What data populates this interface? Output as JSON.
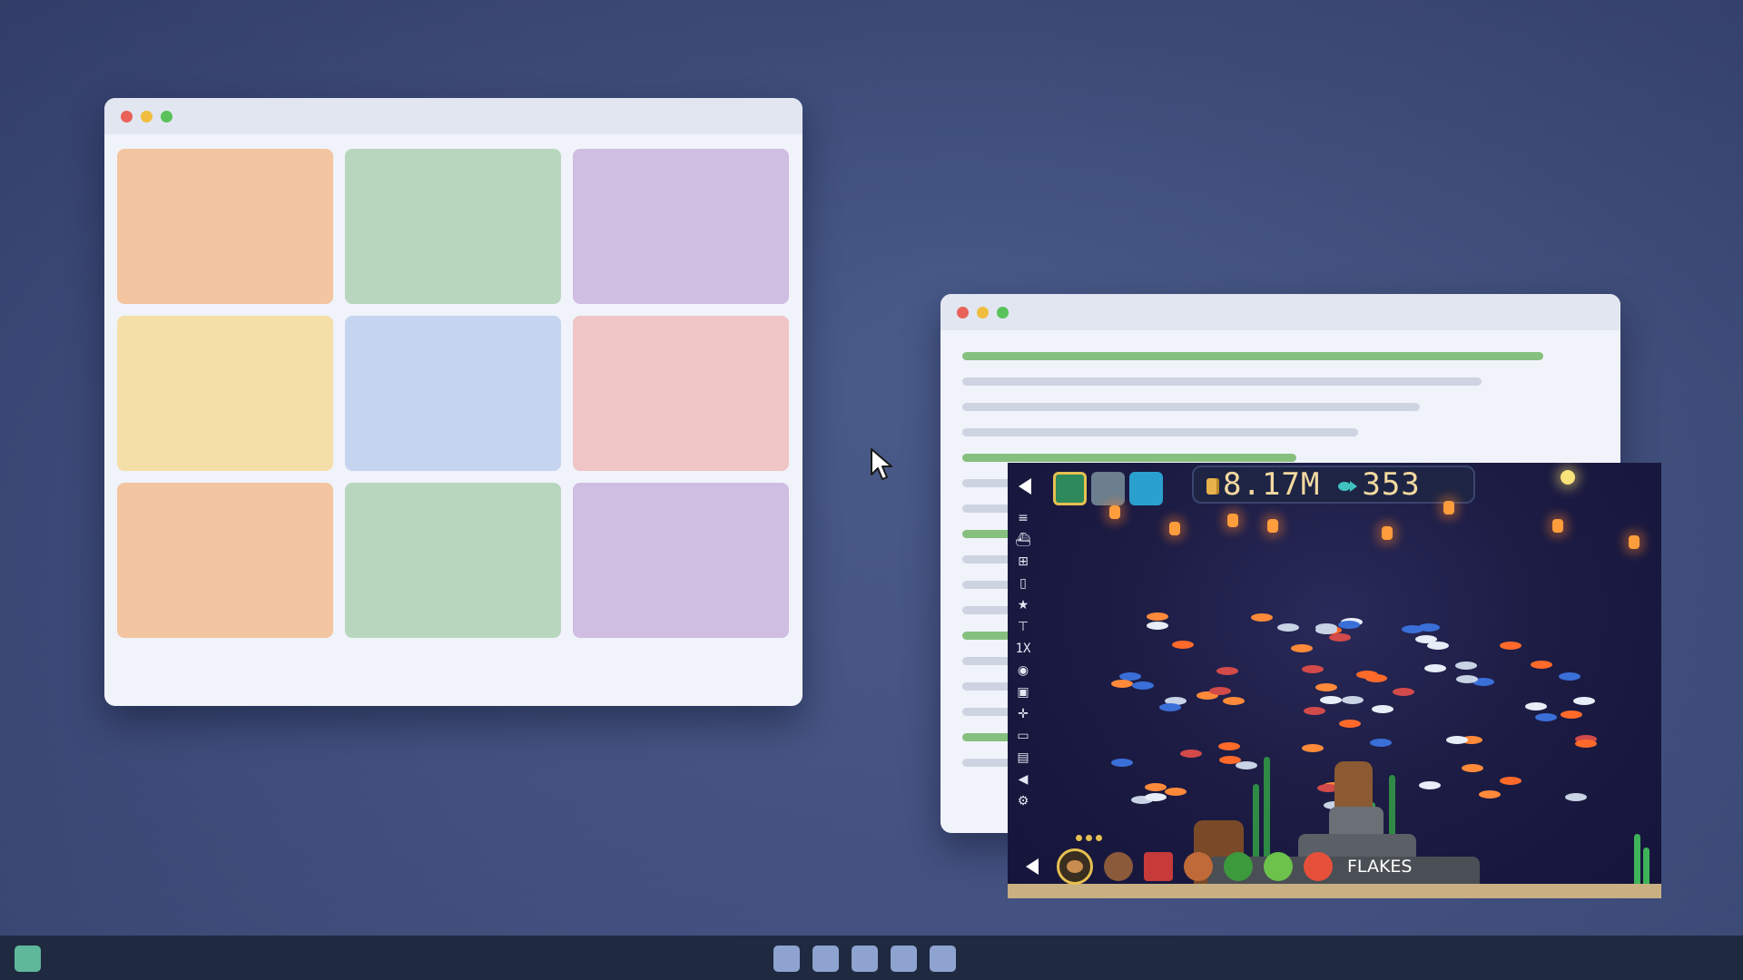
{
  "desktop": {
    "background": "#44527f"
  },
  "window_grid": {
    "tiles": [
      {
        "color": "#f3c5a0"
      },
      {
        "color": "#b7d6bd"
      },
      {
        "color": "#d0bde2"
      },
      {
        "color": "#f5dfa8"
      },
      {
        "color": "#c5d5f0"
      },
      {
        "color": "#efc5c6"
      },
      {
        "color": "#f3c5a0"
      },
      {
        "color": "#b7d6bd"
      },
      {
        "color": "#d0bde2"
      }
    ]
  },
  "window_doc": {
    "lines": [
      "green",
      "gray",
      "gray",
      "gray",
      "green",
      "gray",
      "gray",
      "green",
      "gray",
      "gray",
      "gray",
      "green",
      "gray",
      "gray",
      "gray",
      "green",
      "gray"
    ]
  },
  "game": {
    "hud": {
      "coins": "8.17M",
      "fish_count": "353",
      "swatches": [
        "#2e8a5a",
        "#6b7f8f",
        "#2aa0cf"
      ]
    },
    "sidebar": {
      "speed_label": "1X",
      "icons": [
        "menu-icon",
        "boat-icon",
        "grid-icon",
        "clipboard-icon",
        "star-icon",
        "tools-icon",
        "speed",
        "eye-icon",
        "camera-icon",
        "move-icon",
        "monitor-icon",
        "lock-icon",
        "sound-icon",
        "gear-icon"
      ]
    },
    "food_bar": {
      "selected_food_label": "FLAKES",
      "items": [
        "pellets-icon",
        "seeds-icon",
        "worms-icon",
        "shrimp-icon",
        "green-pellet-icon",
        "algae-icon",
        "flakes-icon"
      ]
    }
  },
  "taskbar": {
    "start_color": "#5fb89a",
    "item_count": 5
  }
}
